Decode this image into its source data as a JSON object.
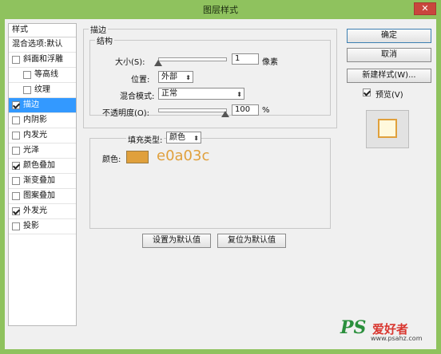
{
  "window": {
    "title": "图层样式",
    "close_label": "✕"
  },
  "sidebar": {
    "header": "样式",
    "blend_options": "混合选项:默认",
    "items": [
      {
        "label": "斜面和浮雕",
        "checked": false,
        "indent": false,
        "selected": false
      },
      {
        "label": "等高线",
        "checked": false,
        "indent": true,
        "selected": false
      },
      {
        "label": "纹理",
        "checked": false,
        "indent": true,
        "selected": false
      },
      {
        "label": "描边",
        "checked": true,
        "indent": false,
        "selected": true
      },
      {
        "label": "内阴影",
        "checked": false,
        "indent": false,
        "selected": false
      },
      {
        "label": "内发光",
        "checked": false,
        "indent": false,
        "selected": false
      },
      {
        "label": "光泽",
        "checked": false,
        "indent": false,
        "selected": false
      },
      {
        "label": "颜色叠加",
        "checked": true,
        "indent": false,
        "selected": false
      },
      {
        "label": "渐变叠加",
        "checked": false,
        "indent": false,
        "selected": false
      },
      {
        "label": "图案叠加",
        "checked": false,
        "indent": false,
        "selected": false
      },
      {
        "label": "外发光",
        "checked": true,
        "indent": false,
        "selected": false
      },
      {
        "label": "投影",
        "checked": false,
        "indent": false,
        "selected": false
      }
    ]
  },
  "stroke": {
    "section_title": "描边",
    "structure_title": "结构",
    "size_label": "大小(S):",
    "size_value": "1",
    "size_unit": "像素",
    "size_slider_fraction": 0.0,
    "position_label": "位置:",
    "position_value": "外部",
    "blend_label": "混合模式:",
    "blend_value": "正常",
    "opacity_label": "不透明度(O):",
    "opacity_value": "100",
    "opacity_unit": "%",
    "opacity_slider_fraction": 1.0,
    "fill_type_label": "填充类型:",
    "fill_type_value": "颜色",
    "color_label": "颜色:",
    "color_hex": "e0a03c",
    "color_value": "#e0a03c"
  },
  "footer": {
    "set_default": "设置为默认值",
    "reset_default": "复位为默认值"
  },
  "right": {
    "ok": "确定",
    "cancel": "取消",
    "new_style": "新建样式(W)...",
    "preview_label": "预览(V)",
    "preview_checked": true
  },
  "watermark": {
    "ps": "PS",
    "cn": "爱好者",
    "url": "www.psahz.com"
  },
  "colors": {
    "accent": "#3399ff",
    "stroke": "#e0a03c",
    "titlebar": "#8fc25e"
  }
}
